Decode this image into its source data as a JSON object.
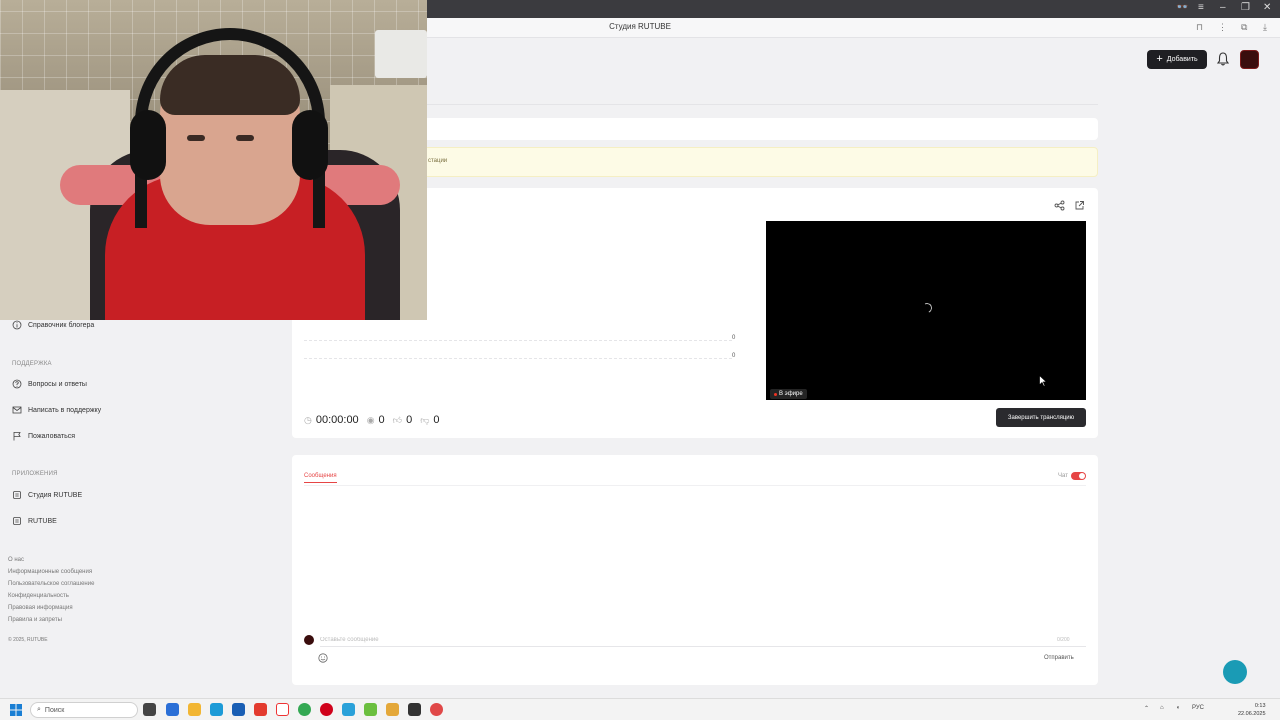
{
  "browser": {
    "tab_title": "Студия RUTUBE"
  },
  "header": {
    "add_label": "Добавить"
  },
  "notice": {
    "text": "стации"
  },
  "stream": {
    "row_values": [
      "0",
      "0"
    ],
    "live_label": "В эфире",
    "duration": "00:00:00",
    "views": "0",
    "likes": "0",
    "dislikes": "0",
    "stop_label": "Завершить трансляцию"
  },
  "chat": {
    "tab_label": "Сообщения",
    "toggle_label": "Чат",
    "input_placeholder": "Оставьте сообщение",
    "counter": "0/200",
    "send_label": "Отправить"
  },
  "sidebar": {
    "top_item": "Справочник блогера",
    "support_heading": "ПОДДЕРЖКА",
    "support_items": [
      "Вопросы и ответы",
      "Написать в поддержку",
      "Пожаловаться"
    ],
    "apps_heading": "ПРИЛОЖЕНИЯ",
    "apps_items": [
      "Студия RUTUBE",
      "RUTUBE"
    ],
    "footer_links": [
      "О нас",
      "Информационные сообщения",
      "Пользовательское соглашение",
      "Конфиденциальность",
      "Правовая информация",
      "Правила и запреты"
    ],
    "copyright": "© 2025, RUTUBE"
  },
  "taskbar": {
    "search_placeholder": "Поиск",
    "lang": "РУС",
    "time": "0:13",
    "date": "22.06.2025"
  },
  "colors": {
    "accent": "#e64545",
    "dark_button": "#1f1f23",
    "notice_bg": "#fdfbe6"
  }
}
